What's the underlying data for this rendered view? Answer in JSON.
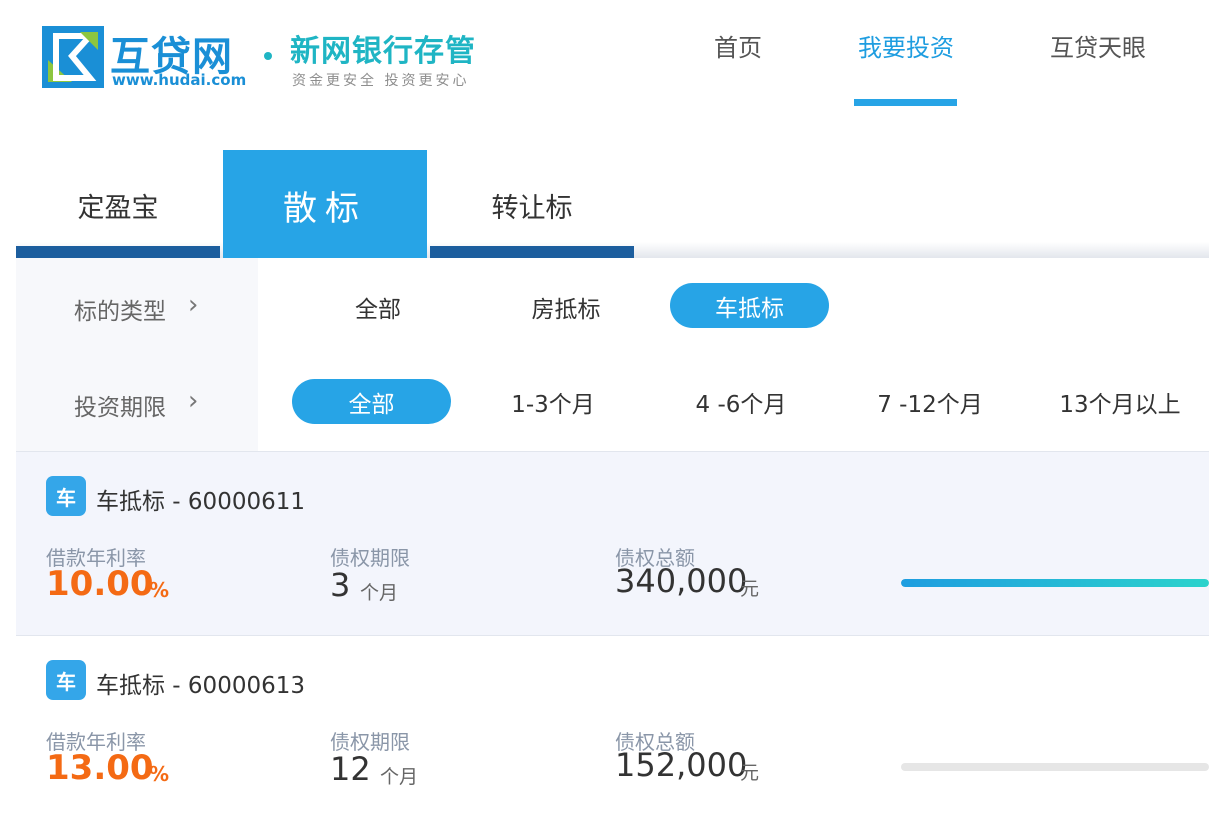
{
  "header": {
    "logo_text": "互贷网",
    "logo_url": "www.hudai.com",
    "slogan": "新网银行存管",
    "slogan_sub": "资金更安全  投资更安心",
    "nav": [
      {
        "label": "首页",
        "active": false
      },
      {
        "label": "我要投资",
        "active": true
      },
      {
        "label": "互贷天眼",
        "active": false
      }
    ]
  },
  "tabs": [
    {
      "label": "定盈宝",
      "active": false
    },
    {
      "label": "散标",
      "active": true
    },
    {
      "label": "转让标",
      "active": false
    }
  ],
  "filters": {
    "type": {
      "label": "标的类型",
      "options": [
        {
          "label": "全部",
          "active": false
        },
        {
          "label": "房抵标",
          "active": false
        },
        {
          "label": "车抵标",
          "active": true
        }
      ]
    },
    "term": {
      "label": "投资期限",
      "options": [
        {
          "label": "全部",
          "active": true
        },
        {
          "label": "1-3个月",
          "active": false
        },
        {
          "label": "4 -6个月",
          "active": false
        },
        {
          "label": "7 -12个月",
          "active": false
        },
        {
          "label": "13个月以上",
          "active": false
        }
      ]
    }
  },
  "listings": [
    {
      "badge": "车",
      "title": "车抵标 - 60000611",
      "rate_label": "借款年利率",
      "rate": "10.00",
      "rate_unit": "%",
      "term_label": "债权期限",
      "term": "3",
      "term_unit": "个月",
      "amount_label": "债权总额",
      "amount": "340,000",
      "amount_unit": "元",
      "progress": 1.0
    },
    {
      "badge": "车",
      "title": "车抵标 - 60000613",
      "rate_label": "借款年利率",
      "rate": "13.00",
      "rate_unit": "%",
      "term_label": "债权期限",
      "term": "12",
      "term_unit": "个月",
      "amount_label": "债权总额",
      "amount": "152,000",
      "amount_unit": "元",
      "progress": 0.0
    }
  ],
  "colors": {
    "brand": "#27a4e6",
    "tab_bar": "#1c5e9e",
    "rate": "#f46a14",
    "slogan": "#1fb5c4"
  }
}
